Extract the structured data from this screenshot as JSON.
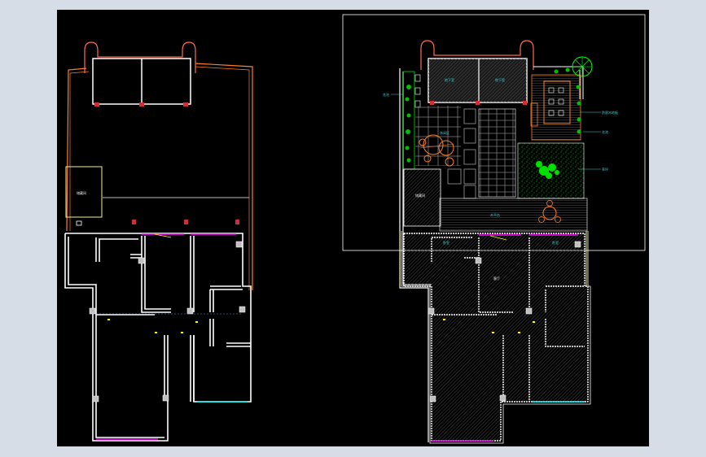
{
  "drawing": {
    "left_plan_labels": {
      "storage_room": "储藏间"
    },
    "right_plan_labels": {
      "room_top_left": "地下室",
      "room_top_right": "地下室",
      "garden_center": "休闲区",
      "lawn": "草坪",
      "side_note_top": "防腐木地板",
      "side_note_mid": "花池",
      "side_note_bottom": "草坪",
      "side_note_left": "花池",
      "deck": "木平台",
      "storage": "储藏间",
      "living_left": "卧室",
      "living_right": "卧室",
      "hall": "客厅"
    },
    "colors": {
      "background": "#000000",
      "frame": "#d6dde7",
      "wall": "#ffffff",
      "wall_red": "#ff6a4d",
      "orange": "#ff7f27",
      "window_magenta": "#ff00ff",
      "window_cyan": "#00ffff",
      "green": "#00ff00",
      "yellow": "#ffff00",
      "pale_yellow": "#f1f0a0",
      "hatch": "#5a5a5a"
    }
  }
}
